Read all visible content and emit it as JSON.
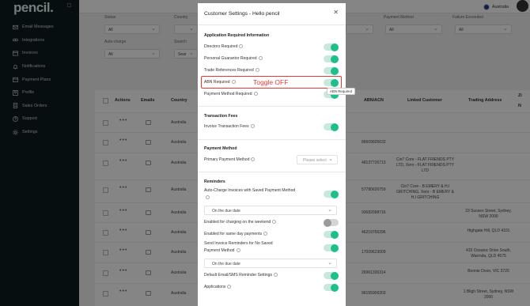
{
  "brand": {
    "logo": "pencil."
  },
  "sidebar": {
    "items": [
      {
        "label": "Email Messages",
        "icon": "envelope-icon"
      },
      {
        "label": "Integrations",
        "icon": "link-icon"
      },
      {
        "label": "Invoices",
        "icon": "invoice-icon"
      },
      {
        "label": "Notifications",
        "icon": "bell-icon"
      },
      {
        "label": "Payment Plans",
        "icon": "calendar-icon"
      },
      {
        "label": "Profile",
        "icon": "user-icon"
      },
      {
        "label": "Sales Orders",
        "icon": "document-icon"
      },
      {
        "label": "Support",
        "icon": "help-icon"
      },
      {
        "label": "Settings",
        "icon": "gear-icon"
      }
    ]
  },
  "topbar": {
    "region": "Australia"
  },
  "filters": {
    "status_label": "Status",
    "country_label": "Country",
    "payment_method_label": "Payment Method",
    "failure_label": "Failure Exceeded",
    "autocharge_label": "Auto-charge",
    "search_label": "Search",
    "all": "All",
    "search_placeholder": "Sear"
  },
  "table": {
    "headers": {
      "actions": "Actions",
      "emails": "Emails",
      "country": "Country",
      "abn": "ABN/ACN",
      "linked": "Linked Customer",
      "address": "Trading Address",
      "zi": "Zi",
      "n": "N"
    },
    "rows": [
      {
        "country": "Australia",
        "abn": "",
        "linked": "",
        "address": ""
      },
      {
        "country": "Australia",
        "abn": "86609605632",
        "linked": "",
        "address": ""
      },
      {
        "country": "Australia",
        "abn": "48137726713",
        "linked": "Cin7 Core - FLAT FRIENDS PTY LTD, Xero - FLAT FRIENDS PTY LTD",
        "address": ""
      },
      {
        "country": "Australia",
        "abn": "57780626759",
        "linked": "Cin7 Core - B EMERY & H.I GRITCHING, Xero - B EMERY & H.I GRITCHING",
        "address": ""
      },
      {
        "country": "Australia",
        "abn": "93682098716",
        "linked": "",
        "address": "23 Sussex Street, Sydney, NSW 2000"
      },
      {
        "country": "Australia",
        "abn": "46219766296",
        "linked": "",
        "address": "Highgate Hill, QLD 4101"
      },
      {
        "country": "Australia",
        "abn": "17009623009",
        "linked": "",
        "address": "415 Oceanic Drive South, Warrnda, QLD 4575"
      },
      {
        "country": "Australia",
        "abn": "26961336314",
        "linked": "",
        "address": "Bonnie Doon, VIC 3720"
      },
      {
        "country": "Australia",
        "abn": "96155906203",
        "linked": "",
        "address": "1 Bligh Street, Sydney, NSW 2000"
      }
    ]
  },
  "modal": {
    "title": "Customer Settings - Hello pencil",
    "sections": {
      "application": "Application Required Information",
      "transaction": "Transaction Fees",
      "payment_method": "Payment Method",
      "reminders": "Reminders"
    },
    "settings": {
      "directors_required": {
        "label": "Directors Required",
        "enabled": true
      },
      "personal_guarantor_required": {
        "label": "Personal Guarantor Required",
        "enabled": true
      },
      "trade_references_required": {
        "label": "Trade References Required",
        "enabled": true
      },
      "abn_required": {
        "label": "ABN Required",
        "enabled": true
      },
      "payment_method_required": {
        "label": "Payment Method Required",
        "enabled": true
      },
      "invoice_transaction_fees": {
        "label": "Invoice Transaction Fees",
        "enabled": true
      },
      "primary_payment_method": {
        "label": "Primary Payment Method",
        "placeholder": "Please select"
      },
      "auto_charge_invoices": {
        "label": "Auto-Charge Invoices with Saved Payment Method",
        "enabled": true,
        "timing": "On the due date"
      },
      "charging_on_weekend": {
        "label": "Enabled for charging on the weekend",
        "enabled": false
      },
      "same_day_payments": {
        "label": "Enabled for same day payments",
        "enabled": true
      },
      "send_invoice_reminders": {
        "label": "Send Invoice Reminders for No Saved Payment Method",
        "enabled": true,
        "timing": "On the due date"
      },
      "default_email_sms": {
        "label": "Default Email/SMS Reminder Settings",
        "enabled": true
      },
      "applications": {
        "label": "Applications",
        "enabled": true
      }
    },
    "close_icon": "close-icon"
  },
  "annotation": {
    "text": "Toggle OFF",
    "color": "#e53935"
  },
  "tooltip": {
    "text": "ABN Required"
  },
  "colors": {
    "accent": "#1fbf8c",
    "sidebar": "#0f1b1f",
    "annotation": "#e53935"
  }
}
